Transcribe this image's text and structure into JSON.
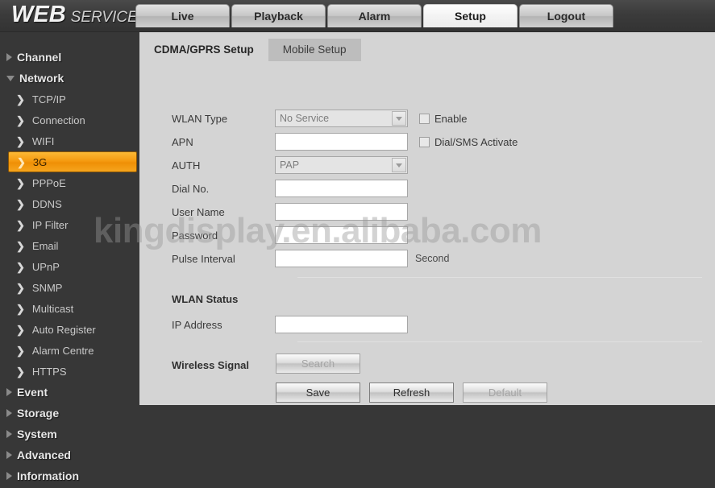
{
  "header": {
    "logo_main": "WEB",
    "logo_sub": "SERVICE",
    "nav_tabs": [
      {
        "label": "Live",
        "active": false
      },
      {
        "label": "Playback",
        "active": false
      },
      {
        "label": "Alarm",
        "active": false
      },
      {
        "label": "Setup",
        "active": true
      },
      {
        "label": "Logout",
        "active": false
      }
    ]
  },
  "sidebar": {
    "groups": [
      {
        "label": "Channel",
        "expanded": false
      },
      {
        "label": "Network",
        "expanded": true
      }
    ],
    "network_items": [
      {
        "label": "TCP/IP",
        "active": false
      },
      {
        "label": "Connection",
        "active": false
      },
      {
        "label": "WIFI",
        "active": false
      },
      {
        "label": "3G",
        "active": true
      },
      {
        "label": "PPPoE",
        "active": false
      },
      {
        "label": "DDNS",
        "active": false
      },
      {
        "label": "IP Filter",
        "active": false
      },
      {
        "label": "Email",
        "active": false
      },
      {
        "label": "UPnP",
        "active": false
      },
      {
        "label": "SNMP",
        "active": false
      },
      {
        "label": "Multicast",
        "active": false
      },
      {
        "label": "Auto Register",
        "active": false
      },
      {
        "label": "Alarm Centre",
        "active": false
      },
      {
        "label": "HTTPS",
        "active": false
      }
    ],
    "bottom_groups": [
      {
        "label": "Event"
      },
      {
        "label": "Storage"
      },
      {
        "label": "System"
      },
      {
        "label": "Advanced"
      },
      {
        "label": "Information"
      }
    ],
    "chevron": "❯"
  },
  "content": {
    "tabs": [
      {
        "label": "CDMA/GPRS Setup",
        "active": true
      },
      {
        "label": "Mobile Setup",
        "active": false
      }
    ],
    "form": {
      "wlan_type_label": "WLAN Type",
      "wlan_type_value": "No Service",
      "enable_label": "Enable",
      "apn_label": "APN",
      "apn_value": "",
      "dial_sms_label": "Dial/SMS Activate",
      "auth_label": "AUTH",
      "auth_value": "PAP",
      "dial_no_label": "Dial No.",
      "dial_no_value": "",
      "user_name_label": "User Name",
      "user_name_value": "",
      "password_label": "Password",
      "password_value": "",
      "pulse_interval_label": "Pulse Interval",
      "pulse_interval_value": "",
      "pulse_interval_unit": "Second"
    },
    "wlan_status": {
      "heading": "WLAN Status",
      "ip_address_label": "IP Address",
      "ip_address_value": ""
    },
    "wireless_signal": {
      "heading": "Wireless Signal",
      "search_label": "Search"
    },
    "buttons": {
      "save_label": "Save",
      "refresh_label": "Refresh",
      "default_label": "Default"
    }
  },
  "watermark": {
    "text": "kingdisplay.en.alibaba.com"
  },
  "colors": {
    "accent": "#f59a10",
    "panel_bg": "#d4d4d4",
    "chrome_bg": "#373737"
  }
}
